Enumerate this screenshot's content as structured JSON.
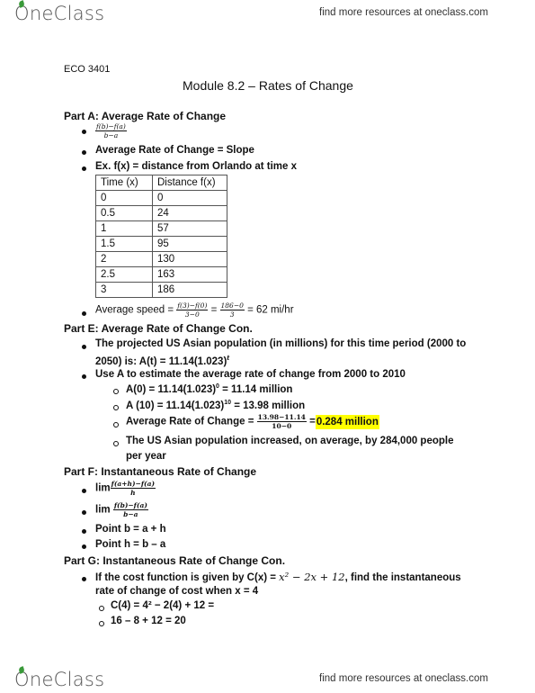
{
  "header": {
    "logo": "OneClass",
    "tagline": "find more resources at oneclass.com"
  },
  "footer": {
    "logo": "OneClass",
    "tagline": "find more resources at oneclass.com"
  },
  "doc": {
    "course": "ECO 3401",
    "title": "Module 8.2 – Rates of Change",
    "partA": {
      "heading": "Part A: Average Rate of Change",
      "formula_num": "f(b)−f(a)",
      "formula_den": "b−a",
      "slope": "Average Rate of Change = Slope",
      "example": "Ex. f(x) = distance from Orlando at time x",
      "table": {
        "headers": [
          "Time (x)",
          "Distance f(x)"
        ],
        "rows": [
          [
            "0",
            "0"
          ],
          [
            "0.5",
            "24"
          ],
          [
            "1",
            "57"
          ],
          [
            "1.5",
            "95"
          ],
          [
            "2",
            "130"
          ],
          [
            "2.5",
            "163"
          ],
          [
            "3",
            "186"
          ]
        ]
      },
      "speed_label": "Average speed =",
      "speed_frac1_num": "f(3)−f(0)",
      "speed_frac1_den": "3−0",
      "speed_frac2_num": "186−0",
      "speed_frac2_den": "3",
      "speed_result": "= 62 mi/hr"
    },
    "partE": {
      "heading": "Part E: Average Rate of Change Con.",
      "b1_line1": "The projected US Asian population (in millions) for this time period (2000 to",
      "b1_line2": "2050) is: A(t) = 11.14(1.023)",
      "b1_exp": "t",
      "b2": "Use A to estimate the average rate of change from 2000 to 2010",
      "s1": "A(0) = 11.14(1.023)",
      "s1_exp": "0",
      "s1_tail": " = 11.14 million",
      "s2": "A (10) = 11.14(1.023)",
      "s2_exp": "10",
      "s2_tail": " = 13.98 million",
      "s3_label": "Average Rate of Change =",
      "s3_num": "13.98−11.14",
      "s3_den": "10−0",
      "s3_eq": "=",
      "s3_result": "0.284 million",
      "s4_line1": "The US Asian population increased, on average, by 284,000 people",
      "s4_line2": "per year"
    },
    "partF": {
      "heading": "Part F: Instantaneous Rate of Change",
      "lim": "lim",
      "f1_num": "f(a+h)−f(a)",
      "f1_den": "h",
      "f2_num": "f(b)−f(a)",
      "f2_den": "b−a",
      "b3": "Point b = a + h",
      "b4": "Point h = b – a"
    },
    "partG": {
      "heading": "Part G: Instantaneous Rate of Change Con.",
      "b1_pre": "If the cost function is given by C(x) = ",
      "b1_math": "x² − 2x + 12",
      "b1_post": ", find the instantaneous",
      "b1_line2": "rate of change of cost when x = 4",
      "s1": "C(4) = 4² − 2(4) + 12 =",
      "s2": "16 – 8 + 12 = 20"
    }
  },
  "colors": {
    "highlight": "#ffff00",
    "logo_leaf": "#3a9a3a"
  }
}
